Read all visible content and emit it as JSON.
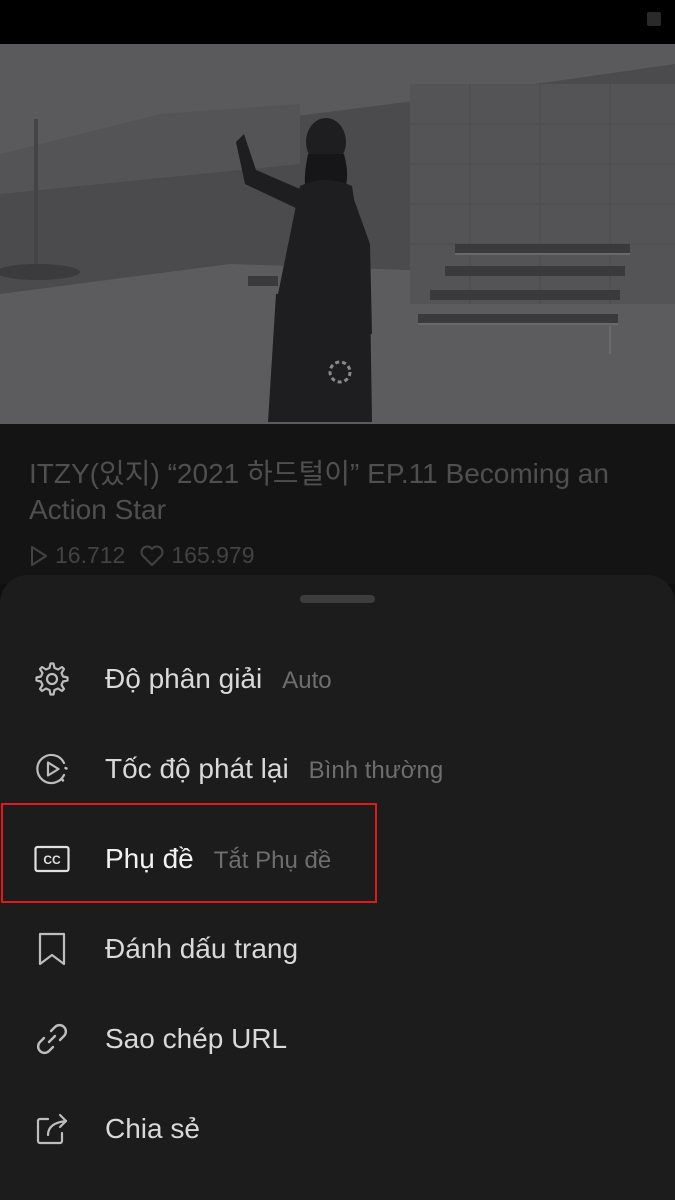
{
  "video": {
    "title": "ITZY(있지) “2021 하드털이” EP.11 Becoming an Action Star",
    "views": "16.712",
    "likes": "165.979"
  },
  "menu": {
    "items": [
      {
        "label": "Độ phân giải",
        "value": "Auto",
        "icon": "gear-icon"
      },
      {
        "label": "Tốc độ phát lại",
        "value": "Bình thường",
        "icon": "playback-speed-icon"
      },
      {
        "label": "Phụ đề",
        "value": "Tắt Phụ đề",
        "icon": "cc-icon",
        "highlighted": true
      },
      {
        "label": "Đánh dấu trang",
        "value": "",
        "icon": "bookmark-icon"
      },
      {
        "label": "Sao chép URL",
        "value": "",
        "icon": "link-icon"
      },
      {
        "label": "Chia sẻ",
        "value": "",
        "icon": "share-icon"
      }
    ]
  },
  "colors": {
    "highlight_border": "#e01a1a",
    "sheet_bg": "#1c1c1c",
    "accent_text": "#d9d9d9"
  }
}
